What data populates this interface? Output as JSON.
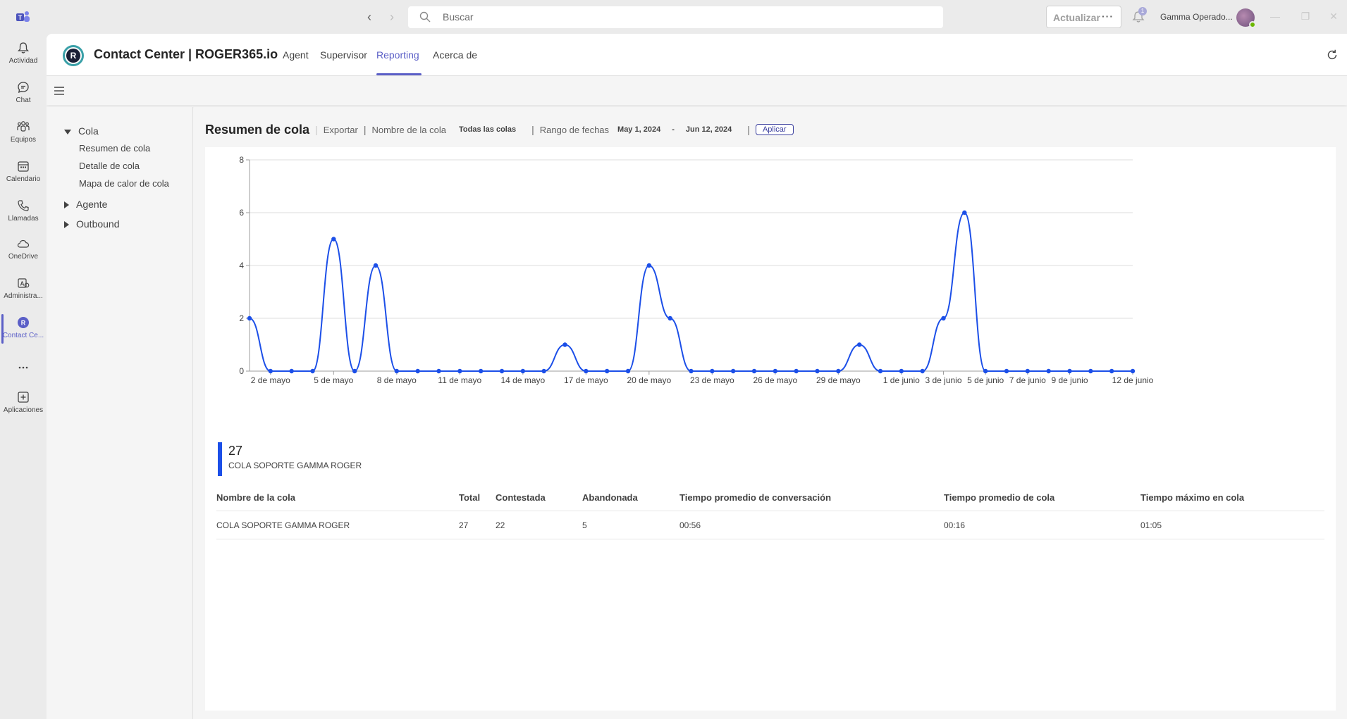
{
  "titlebar": {
    "search_placeholder": "Buscar",
    "update_label": "Actualizar",
    "notification_count": "1",
    "user_name": "Gamma Operado..."
  },
  "rail": {
    "items": [
      {
        "label": "Actividad",
        "icon": "bell-icon"
      },
      {
        "label": "Chat",
        "icon": "chat-icon"
      },
      {
        "label": "Equipos",
        "icon": "teams-icon"
      },
      {
        "label": "Calendario",
        "icon": "calendar-icon"
      },
      {
        "label": "Llamadas",
        "icon": "phone-icon"
      },
      {
        "label": "OneDrive",
        "icon": "cloud-icon"
      },
      {
        "label": "Administra...",
        "icon": "admin-icon"
      },
      {
        "label": "Contact Ce...",
        "icon": "roger-icon"
      },
      {
        "label": "Aplicaciones",
        "icon": "add-apps-icon"
      }
    ]
  },
  "header": {
    "logo_letter": "R",
    "title": "Contact Center | ROGER365.io",
    "tabs": [
      {
        "label": "Agent"
      },
      {
        "label": "Supervisor"
      },
      {
        "label": "Reporting",
        "active": true
      },
      {
        "label": "Acerca de"
      }
    ]
  },
  "tree": {
    "cola": "Cola",
    "cola_children": [
      "Resumen de cola",
      "Detalle de cola",
      "Mapa de calor de cola"
    ],
    "agente": "Agente",
    "outbound": "Outbound"
  },
  "filters": {
    "report_title": "Resumen de cola",
    "export_label": "Exportar",
    "queue_name_label": "Nombre de la cola",
    "queue_name_value": "Todas las colas",
    "date_range_label": "Rango de fechas",
    "date_from": "May 1, 2024",
    "date_dash": "-",
    "date_to": "Jun 12, 2024",
    "apply_label": "Aplicar"
  },
  "chart_data": {
    "type": "line",
    "x": [
      "1 de mayo",
      "2 de mayo",
      "3 de mayo",
      "4 de mayo",
      "5 de mayo",
      "6 de mayo",
      "7 de mayo",
      "8 de mayo",
      "9 de mayo",
      "10 de mayo",
      "11 de mayo",
      "12 de mayo",
      "13 de mayo",
      "14 de mayo",
      "15 de mayo",
      "16 de mayo",
      "17 de mayo",
      "18 de mayo",
      "19 de mayo",
      "20 de mayo",
      "21 de mayo",
      "22 de mayo",
      "23 de mayo",
      "24 de mayo",
      "25 de mayo",
      "26 de mayo",
      "27 de mayo",
      "28 de mayo",
      "29 de mayo",
      "30 de mayo",
      "31 de mayo",
      "1 de junio",
      "2 de junio",
      "3 de junio",
      "4 de junio",
      "5 de junio",
      "6 de junio",
      "7 de junio",
      "8 de junio",
      "9 de junio",
      "10 de junio",
      "11 de junio",
      "12 de junio"
    ],
    "values": [
      2,
      0,
      0,
      0,
      5,
      0,
      4,
      0,
      0,
      0,
      0,
      0,
      0,
      0,
      0,
      1,
      0,
      0,
      0,
      4,
      2,
      0,
      0,
      0,
      0,
      0,
      0,
      0,
      0,
      1,
      0,
      0,
      0,
      2,
      6,
      0,
      0,
      0,
      0,
      0,
      0,
      0,
      0
    ],
    "x_tick_labels": [
      "2 de mayo",
      "5 de mayo",
      "8 de mayo",
      "11 de mayo",
      "14 de mayo",
      "17 de mayo",
      "20 de mayo",
      "23 de mayo",
      "26 de mayo",
      "29 de mayo",
      "1 de junio",
      "3 de junio",
      "5 de junio",
      "7 de junio",
      "9 de junio",
      "12 de junio"
    ],
    "y_ticks": [
      0,
      2,
      4,
      6,
      8
    ],
    "ylim": [
      0,
      8
    ],
    "grid": true,
    "color": "#1c4fe8"
  },
  "summary": {
    "total": "27",
    "queue_name": "COLA SOPORTE GAMMA ROGER",
    "accent_color": "#1c4fe8"
  },
  "table": {
    "headers": [
      "Nombre de la cola",
      "Total",
      "Contestada",
      "Abandonada",
      "Tiempo promedio de conversación",
      "Tiempo promedio de cola",
      "Tiempo máximo en cola"
    ],
    "rows": [
      [
        "COLA SOPORTE GAMMA ROGER",
        "27",
        "22",
        "5",
        "00:56",
        "00:16",
        "01:05"
      ]
    ]
  }
}
